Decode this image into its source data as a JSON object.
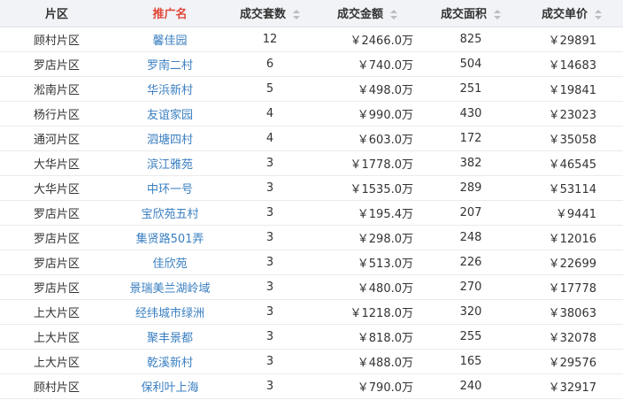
{
  "table": {
    "headers": {
      "district": "片区",
      "name": "推广名",
      "count": "成交套数",
      "amount": "成交金额",
      "area": "成交面积",
      "price": "成交单价"
    },
    "rows": [
      {
        "district": "顾村片区",
        "name": "馨佳园",
        "count": "12",
        "amount": "￥2466.0万",
        "area": "825",
        "price": "￥29891"
      },
      {
        "district": "罗店片区",
        "name": "罗南二村",
        "count": "6",
        "amount": "￥740.0万",
        "area": "504",
        "price": "￥14683"
      },
      {
        "district": "淞南片区",
        "name": "华浜新村",
        "count": "5",
        "amount": "￥498.0万",
        "area": "251",
        "price": "￥19841"
      },
      {
        "district": "杨行片区",
        "name": "友谊家园",
        "count": "4",
        "amount": "￥990.0万",
        "area": "430",
        "price": "￥23023"
      },
      {
        "district": "通河片区",
        "name": "泗塘四村",
        "count": "4",
        "amount": "￥603.0万",
        "area": "172",
        "price": "￥35058"
      },
      {
        "district": "大华片区",
        "name": "滨江雅苑",
        "count": "3",
        "amount": "￥1778.0万",
        "area": "382",
        "price": "￥46545"
      },
      {
        "district": "大华片区",
        "name": "中环一号",
        "count": "3",
        "amount": "￥1535.0万",
        "area": "289",
        "price": "￥53114"
      },
      {
        "district": "罗店片区",
        "name": "宝欣苑五村",
        "count": "3",
        "amount": "￥195.4万",
        "area": "207",
        "price": "￥9441"
      },
      {
        "district": "罗店片区",
        "name": "集贤路501弄",
        "count": "3",
        "amount": "￥298.0万",
        "area": "248",
        "price": "￥12016"
      },
      {
        "district": "罗店片区",
        "name": "佳欣苑",
        "count": "3",
        "amount": "￥513.0万",
        "area": "226",
        "price": "￥22699"
      },
      {
        "district": "罗店片区",
        "name": "景瑞美兰湖岭域",
        "count": "3",
        "amount": "￥480.0万",
        "area": "270",
        "price": "￥17778"
      },
      {
        "district": "上大片区",
        "name": "经纬城市绿洲",
        "count": "3",
        "amount": "￥1218.0万",
        "area": "320",
        "price": "￥38063"
      },
      {
        "district": "上大片区",
        "name": "聚丰景都",
        "count": "3",
        "amount": "￥818.0万",
        "area": "255",
        "price": "￥32078"
      },
      {
        "district": "上大片区",
        "name": "乾溪新村",
        "count": "3",
        "amount": "￥488.0万",
        "area": "165",
        "price": "￥29576"
      },
      {
        "district": "顾村片区",
        "name": "保利叶上海",
        "count": "3",
        "amount": "￥790.0万",
        "area": "240",
        "price": "￥32917"
      }
    ]
  },
  "colors": {
    "header_bg": "#f1f3f6",
    "active_header": "#e2483b",
    "link": "#3a7fc1",
    "text": "#333333"
  }
}
